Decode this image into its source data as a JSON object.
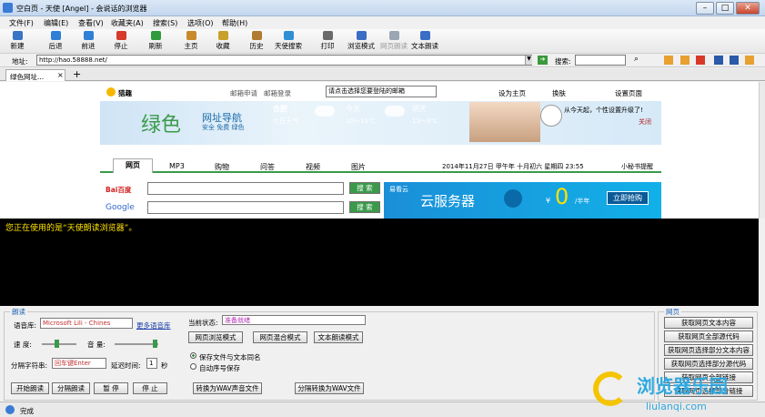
{
  "window": {
    "title": "空白页 - 天使 [Angel] - 会说话的浏览器"
  },
  "menu": [
    "文件(F)",
    "编辑(E)",
    "查看(V)",
    "收藏夹(A)",
    "搜索(S)",
    "选项(O)",
    "帮助(H)"
  ],
  "toolbar": [
    {
      "label": "新建",
      "icon": "new-icon",
      "color": "#3a74c4"
    },
    {
      "label": "后退",
      "icon": "back-icon",
      "color": "#2f7fd6"
    },
    {
      "label": "前进",
      "icon": "forward-icon",
      "color": "#2f7fd6"
    },
    {
      "label": "停止",
      "icon": "stop-icon",
      "color": "#d63a2a"
    },
    {
      "label": "刷新",
      "icon": "refresh-icon",
      "color": "#2e9b3c"
    },
    {
      "label": "主页",
      "icon": "home-icon",
      "color": "#c88a2a"
    },
    {
      "label": "收藏",
      "icon": "favorites-icon",
      "color": "#c8a02a"
    },
    {
      "label": "历史",
      "icon": "history-icon",
      "color": "#b07a30"
    },
    {
      "label": "天使搜索",
      "icon": "angel-search-icon",
      "color": "#2f8fd6"
    },
    {
      "label": "打印",
      "icon": "print-icon",
      "color": "#6a6a6a"
    },
    {
      "label": "浏览模式",
      "icon": "browse-mode-icon",
      "color": "#3a6ec4"
    },
    {
      "label": "网页朗读",
      "icon": "read-page-icon",
      "color": "#9aa6b4"
    },
    {
      "label": "文本朗读",
      "icon": "read-text-icon",
      "color": "#3a6ec4"
    }
  ],
  "address": {
    "label": "地址:",
    "url": "http://hao.58888.net/",
    "search_label": "搜索:"
  },
  "tab": {
    "title": "绿色网址..."
  },
  "webpage": {
    "logo": "猎趣",
    "mail_apply": "邮箱申请",
    "mail_login": "邮箱登录",
    "mail_placeholder": "请点击选择您要登陆的邮箱",
    "set_home": "设为主页",
    "skin": "换肤",
    "settings": "设置页面",
    "brand": "绿色",
    "nav_title": "网址导航",
    "nav_sub": "安全 免费 绿色",
    "city": "合肥",
    "weather_today": "七日天气",
    "today": "今天",
    "today_temp": "10～13℃",
    "tomorrow": "明天",
    "tomorrow_temp": "13～9℃",
    "promo_text": "从今天起，个性设置升级了!",
    "promo_close": "关闭",
    "tabs": [
      "网页",
      "MP3",
      "购物",
      "问答",
      "视频",
      "图片"
    ],
    "date": "2014年11月27日 甲午年 十月初六 星期四 23:55",
    "secretary": "小秘书提醒",
    "search_btn": "搜 索",
    "baidu": "Bai百度",
    "google": "Google",
    "ad_brand": "易看云",
    "ad_title": "云服务器",
    "ad_price": "0",
    "ad_unit": "/半年",
    "ad_currency": "¥",
    "ad_btn": "立即抢购"
  },
  "console": {
    "text": "您正在使用的是“天使朗读浏览器”。"
  },
  "panel": {
    "read_group": "朗读",
    "voice_label": "语音库:",
    "voice_value": "Microsoft Lili - Chines",
    "more_voice": "更多语音库",
    "speed_label": "速 度:",
    "volume_label": "音 量:",
    "delim_label": "分隔字符串:",
    "delim_value": "回车键Enter",
    "delay_label": "延迟时间:",
    "delay_value": "1",
    "delay_unit": "秒",
    "status_label": "当前状态:",
    "status_value": "准备就绪",
    "btn_browse": "网页浏览模式",
    "btn_mixed": "网页混合模式",
    "btn_text": "文本朗读模式",
    "radio1": "保存文件与文本同名",
    "radio2": "自动序号保存",
    "btn_start": "开始朗读",
    "btn_seg": "分隔朗读",
    "btn_pause": "暂 停",
    "btn_stop": "停 止",
    "btn_wav": "转换为WAV声音文件",
    "btn_seg_wav": "分隔转换为WAV文件",
    "web_group": "网页",
    "web_btns": [
      "获取网页文本内容",
      "获取网页全部源代码",
      "获取网页选择部分文本内容",
      "获取网页选择部分源代码",
      "获取网页全部链接",
      "获取网页选择部分链接"
    ]
  },
  "status": {
    "text": "完成"
  },
  "watermark": {
    "text": "浏览器乐园",
    "url": "liulanqi.com"
  }
}
